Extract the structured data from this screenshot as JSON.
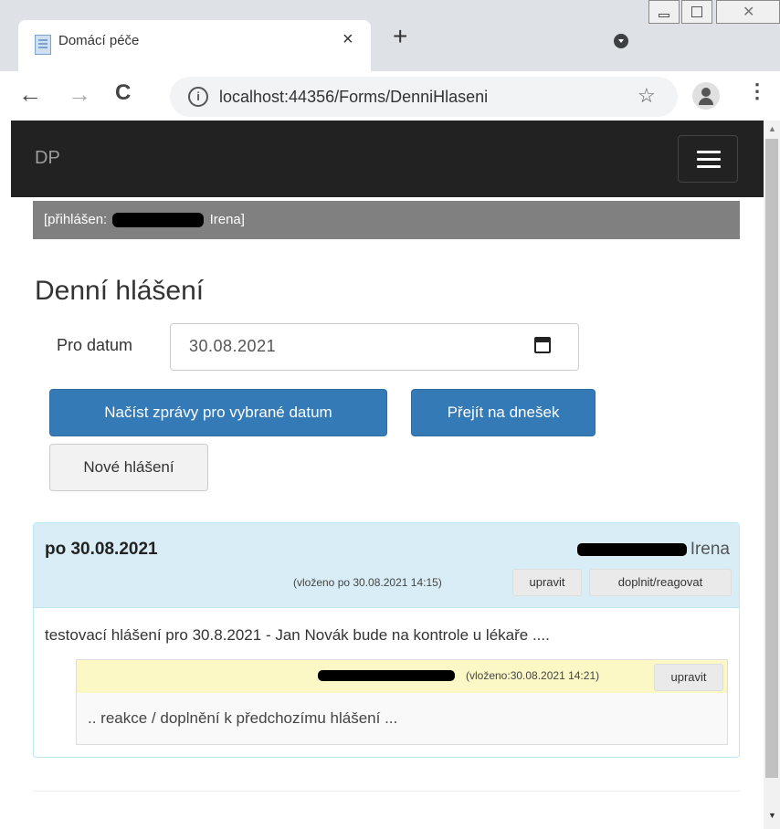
{
  "browser": {
    "tab_title": "Domácí péče",
    "tab_close": "×",
    "new_tab": "+",
    "url": "localhost:44356/Forms/DenniHlaseni",
    "win_close": "✕"
  },
  "navbar": {
    "brand": "DP"
  },
  "login": {
    "prefix": "[přihlášen:",
    "name": "Irena]"
  },
  "page": {
    "title": "Denní hlášení",
    "date_label": "Pro datum",
    "date_value": "30.08.2021",
    "load_button": "Načíst zprávy pro vybrané datum",
    "today_button": "Přejít na dnešek",
    "new_button": "Nové hlášení"
  },
  "report": {
    "date": "po 30.08.2021",
    "author_visible": "Irena",
    "inserted": "(vloženo po 30.08.2021 14:15)",
    "edit_label": "upravit",
    "reply_label": "doplnit/reagovat",
    "message": "testovací hlášení pro 30.8.2021 - Jan Novák bude na kontrole u lékaře ....",
    "reaction": {
      "inserted": "(vloženo:30.08.2021 14:21)",
      "edit_label": "upravit",
      "text": ".. reakce / doplnění k předchozímu hlášení ..."
    }
  },
  "icons": {
    "back": "arrow-left-icon",
    "forward": "arrow-right-icon",
    "reload": "reload-icon",
    "info": "info-icon",
    "star": "star-icon",
    "account": "avatar-icon",
    "menu": "kebab-menu-icon",
    "calendar": "calendar-icon",
    "hamburger": "hamburger-icon"
  },
  "colors": {
    "navbar_bg": "#222222",
    "primary": "#337ab7",
    "panel_heading": "#d9edf7",
    "reply_heading": "#fcf8c6"
  }
}
